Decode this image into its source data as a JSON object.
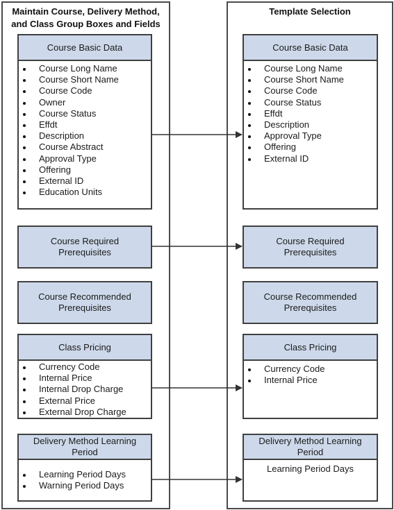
{
  "left_panel": {
    "title_line1": "Maintain Course, Delivery Method,",
    "title_line2": "and Class Group Boxes and Fields",
    "course_basic_data": {
      "title": "Course Basic Data",
      "fields": [
        "Course Long Name",
        "Course Short Name",
        "Course Code",
        "Owner",
        "Course Status",
        "Effdt",
        "Description",
        "Course Abstract",
        "Approval Type",
        "Offering",
        "External ID",
        "Education Units"
      ]
    },
    "course_required_prereq": {
      "title_line1": "Course Required",
      "title_line2": "Prerequisites"
    },
    "course_recommended_prereq": {
      "title_line1": "Course Recommended",
      "title_line2": "Prerequisites"
    },
    "class_pricing": {
      "title": "Class Pricing",
      "fields": [
        "Currency Code",
        "Internal Price",
        "Internal Drop Charge",
        "External Price",
        "External Drop Charge"
      ]
    },
    "delivery_method": {
      "title_line1": "Delivery Method Learning",
      "title_line2": "Period",
      "fields": [
        "Learning Period Days",
        "Warning Period Days"
      ]
    }
  },
  "right_panel": {
    "title": "Template Selection",
    "course_basic_data": {
      "title": "Course Basic Data",
      "fields": [
        "Course Long Name",
        "Course Short Name",
        "Course Code",
        "Course Status",
        "Effdt",
        "Description",
        "Approval Type",
        "Offering",
        "External ID"
      ]
    },
    "course_required_prereq": {
      "title_line1": "Course Required",
      "title_line2": "Prerequisites"
    },
    "course_recommended_prereq": {
      "title_line1": "Course Recommended",
      "title_line2": "Prerequisites"
    },
    "class_pricing": {
      "title": "Class Pricing",
      "fields": [
        "Currency Code",
        "Internal Price"
      ]
    },
    "delivery_method": {
      "title_line1": "Delivery Method Learning",
      "title_line2": "Period",
      "field": "Learning Period Days"
    }
  },
  "colors": {
    "header_fill": "#cdd9ea",
    "border": "#3f3f3f",
    "connector": "#333333"
  }
}
